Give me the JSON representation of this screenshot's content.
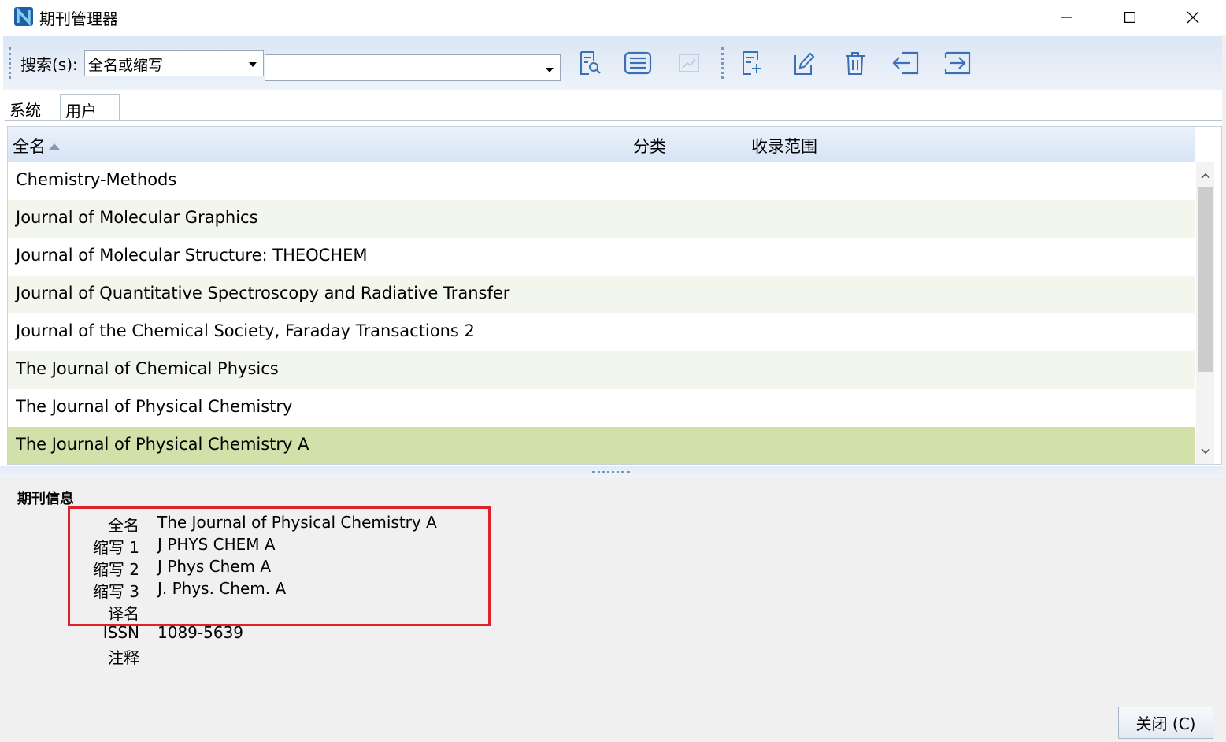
{
  "window": {
    "title": "期刊管理器",
    "min_label": "—",
    "max_label": "□",
    "close_label": "✕"
  },
  "toolbar": {
    "search_label": "搜索(s):",
    "search_mode": "全名或缩写",
    "search_value": "",
    "buttons": [
      "find-icon",
      "list-icon",
      "chart-icon",
      "new-icon",
      "edit-icon",
      "delete-icon",
      "import-icon",
      "export-icon"
    ]
  },
  "tabs": [
    {
      "label": "系统"
    },
    {
      "label": "用户"
    }
  ],
  "grid": {
    "columns": [
      "全名",
      "分类",
      "收录范围"
    ],
    "rows": [
      {
        "name": "Chemistry-Methods",
        "category": "",
        "range": ""
      },
      {
        "name": "Journal of Molecular Graphics",
        "category": "",
        "range": ""
      },
      {
        "name": "Journal of Molecular Structure: THEOCHEM",
        "category": "",
        "range": ""
      },
      {
        "name": "Journal of Quantitative Spectroscopy and Radiative Transfer",
        "category": "",
        "range": ""
      },
      {
        "name": "Journal of the Chemical Society, Faraday Transactions 2",
        "category": "",
        "range": ""
      },
      {
        "name": "The Journal of Chemical Physics",
        "category": "",
        "range": ""
      },
      {
        "name": "The Journal of Physical Chemistry",
        "category": "",
        "range": ""
      },
      {
        "name": "The Journal of Physical Chemistry A",
        "category": "",
        "range": ""
      }
    ],
    "selected_index": 7
  },
  "info": {
    "title": "期刊信息",
    "fields": [
      {
        "key": "全名",
        "value": "The Journal of Physical Chemistry A"
      },
      {
        "key": "缩写 1",
        "value": "J PHYS CHEM A"
      },
      {
        "key": "缩写 2",
        "value": "J Phys Chem A"
      },
      {
        "key": "缩写 3",
        "value": "J. Phys. Chem. A"
      },
      {
        "key": "译名",
        "value": ""
      },
      {
        "key": "ISSN",
        "value": "1089-5639"
      },
      {
        "key": "注释",
        "value": ""
      }
    ]
  },
  "footer": {
    "close_label": "关闭 (C)"
  },
  "colors": {
    "selected_row": "#d1e1a9",
    "alt_row": "#f3f6ec",
    "toolbar_icon": "#3d6fb4",
    "highlight_box": "#e0202a"
  }
}
